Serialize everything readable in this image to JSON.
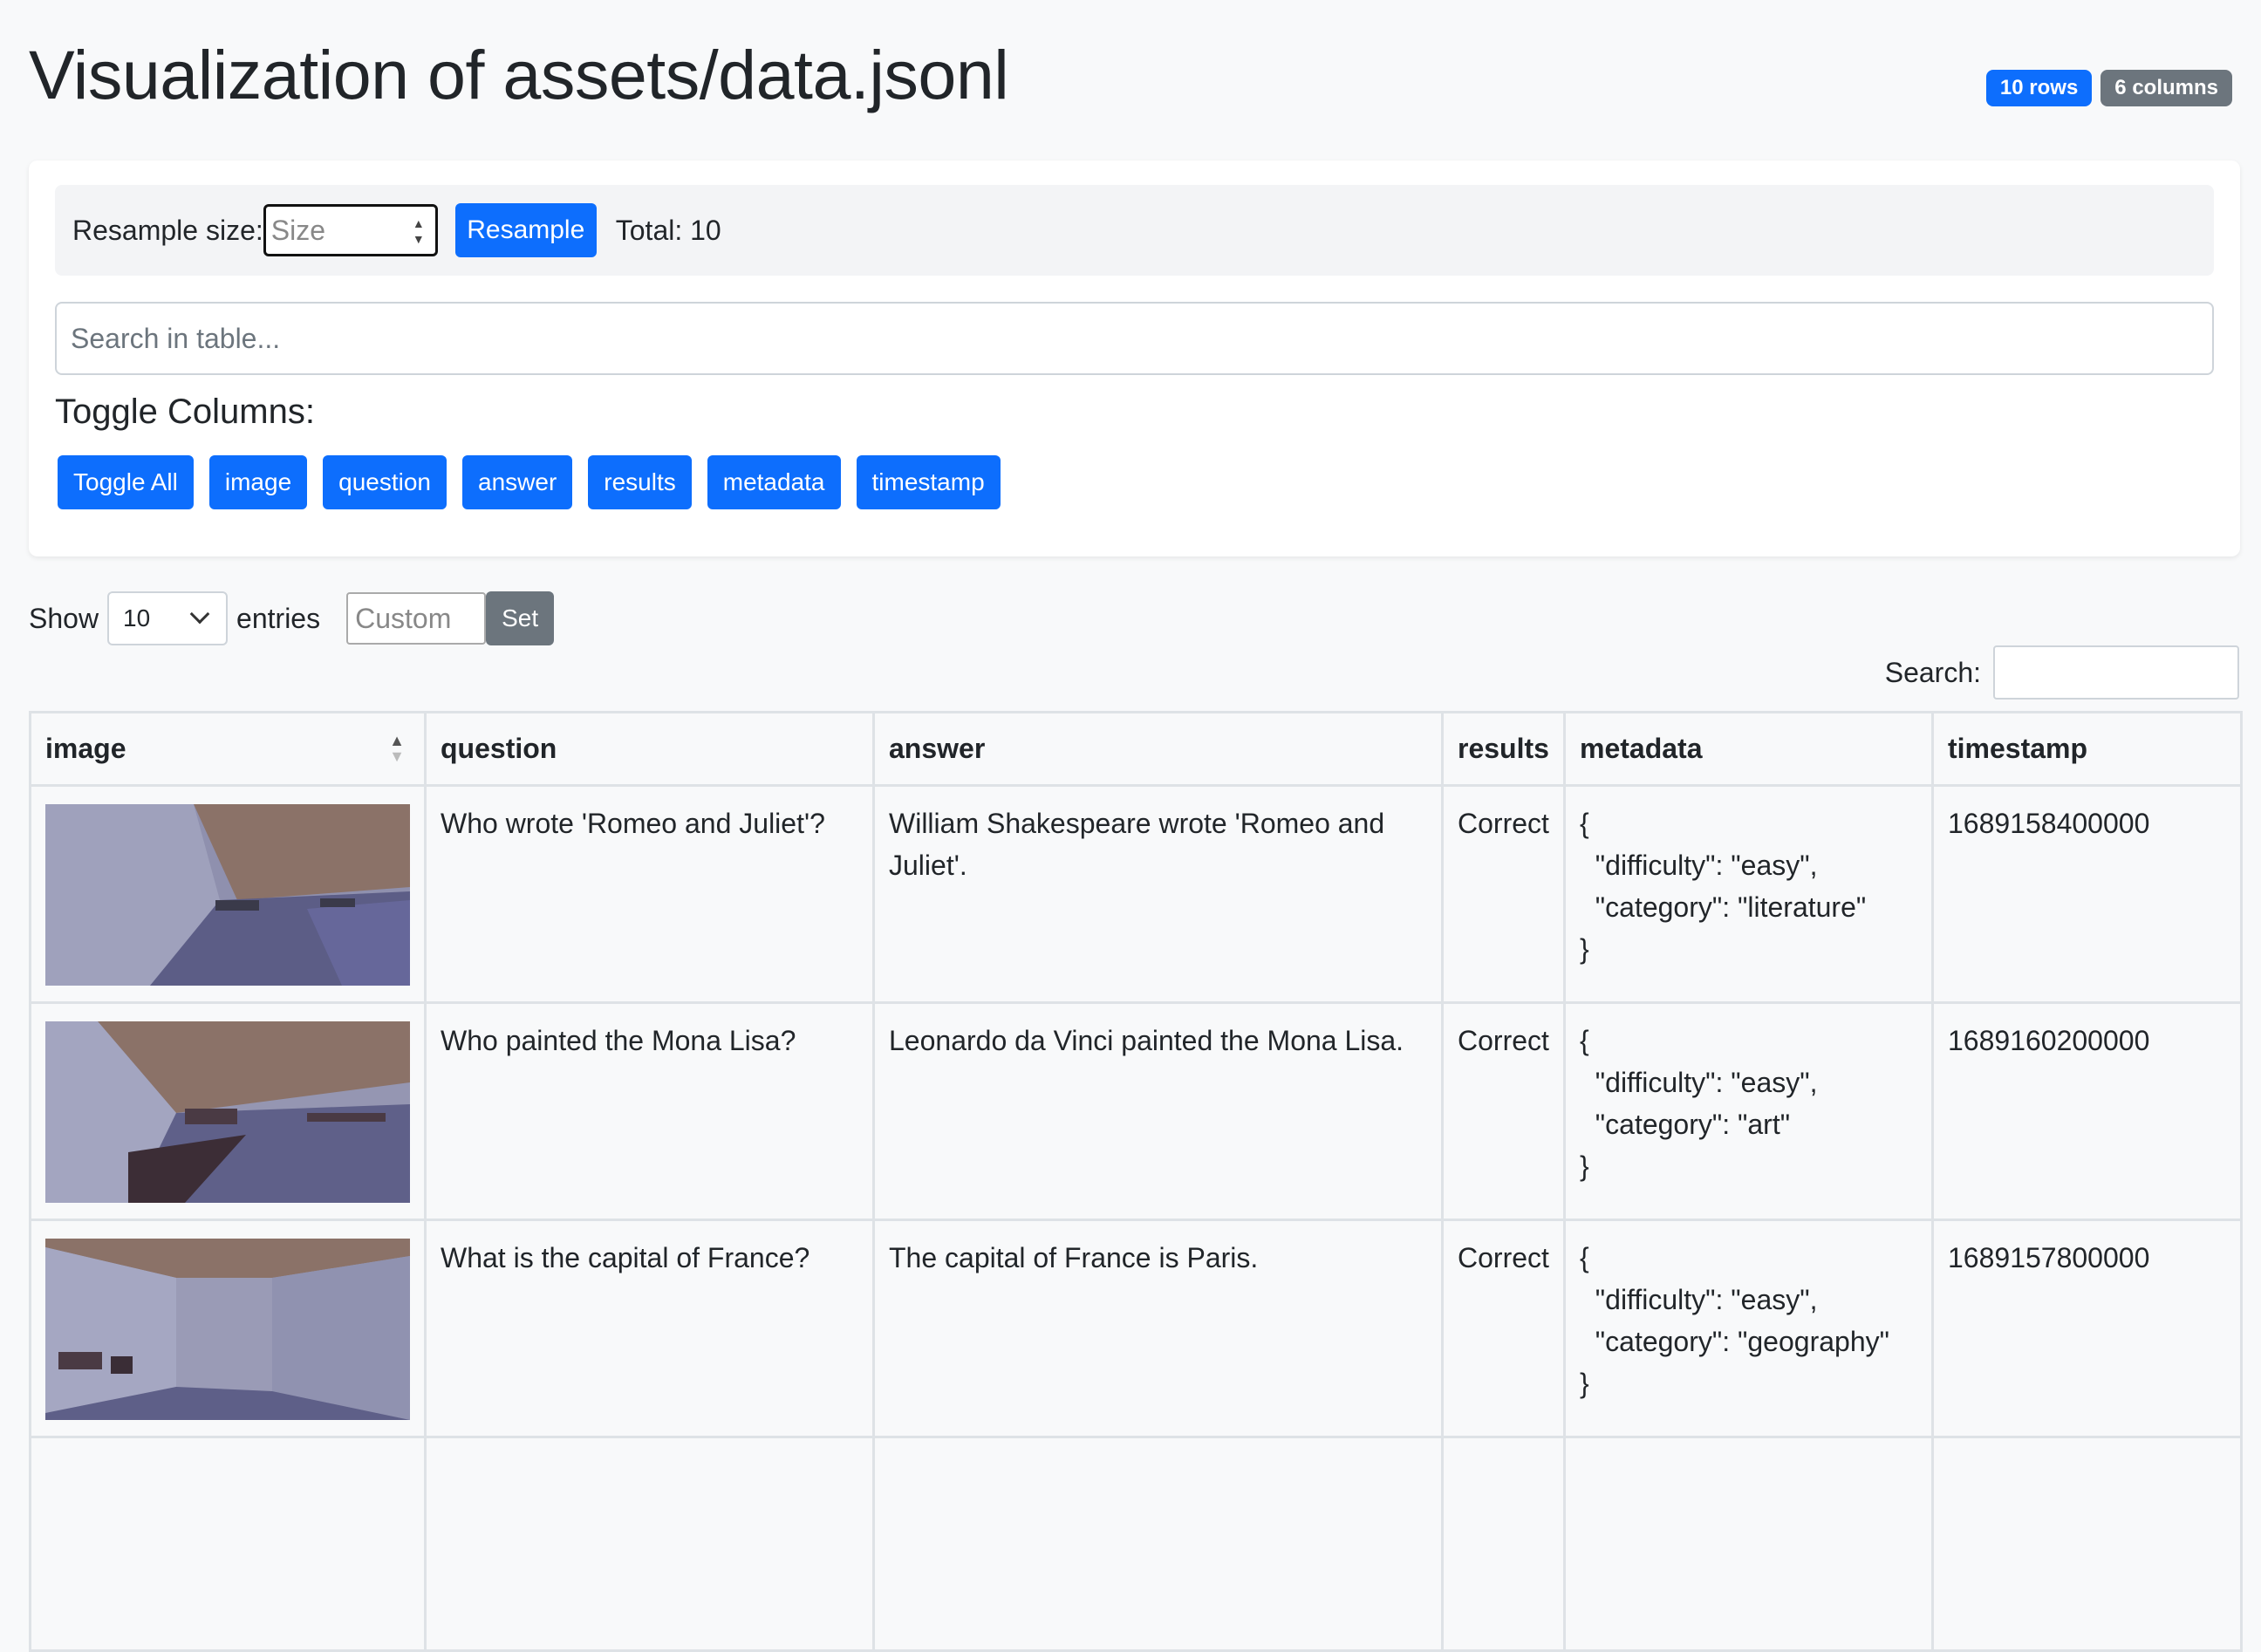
{
  "page": {
    "title": "Visualization of assets/data.jsonl"
  },
  "badges": {
    "rows": "10 rows",
    "columns": "6 columns"
  },
  "resample": {
    "label": "Resample size:",
    "placeholder": "Size",
    "button": "Resample",
    "total": "Total: 10"
  },
  "table_search": {
    "placeholder": "Search in table..."
  },
  "toggle": {
    "title": "Toggle Columns:",
    "buttons": [
      "Toggle All",
      "image",
      "question",
      "answer",
      "results",
      "metadata",
      "timestamp"
    ]
  },
  "length": {
    "show": "Show",
    "value": "10",
    "entries": "entries",
    "custom_placeholder": "Custom",
    "set": "Set"
  },
  "dt_search": {
    "label": "Search:"
  },
  "columns": [
    "image",
    "question",
    "answer",
    "results",
    "metadata",
    "timestamp"
  ],
  "rows": [
    {
      "question": "Who wrote 'Romeo and Juliet'?",
      "answer": "William Shakespeare wrote 'Romeo and Juliet'.",
      "results": "Correct",
      "metadata": [
        "{",
        "  \"difficulty\": \"easy\",",
        "  \"category\": \"literature\"",
        "}"
      ],
      "timestamp": "1689158400000"
    },
    {
      "question": "Who painted the Mona Lisa?",
      "answer": "Leonardo da Vinci painted the Mona Lisa.",
      "results": "Correct",
      "metadata": [
        "{",
        "  \"difficulty\": \"easy\",",
        "  \"category\": \"art\"",
        "}"
      ],
      "timestamp": "1689160200000"
    },
    {
      "question": "What is the capital of France?",
      "answer": "The capital of France is Paris.",
      "results": "Correct",
      "metadata": [
        "{",
        "  \"difficulty\": \"easy\",",
        "  \"category\": \"geography\"",
        "}"
      ],
      "timestamp": "1689157800000"
    }
  ],
  "colors": {
    "primary": "#0d6efd",
    "secondary": "#6c757d",
    "background": "#f8f9fa"
  }
}
